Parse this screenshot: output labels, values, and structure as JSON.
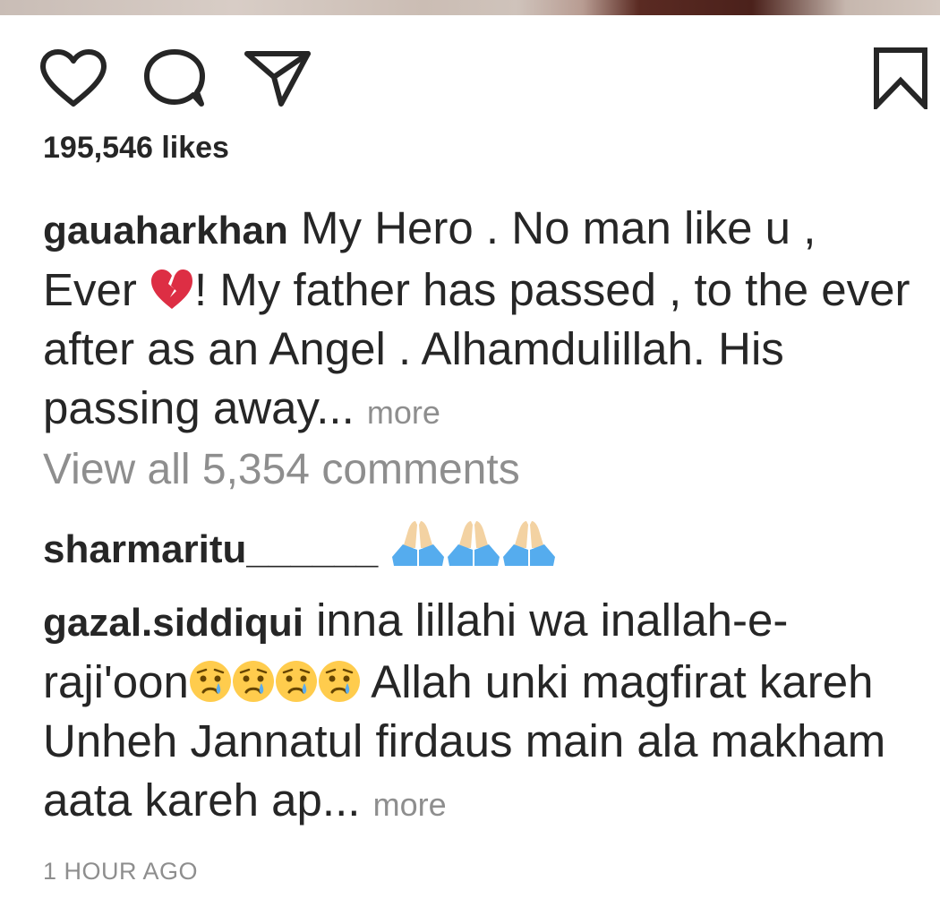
{
  "post": {
    "likes_text": "195,546 likes",
    "caption": {
      "username": "gauaharkhan",
      "text_part1": " My Hero . No man like u , Ever ",
      "emoji": "broken-heart",
      "text_part2": "! My father has passed , to the ever after as an Angel . Alhamdulillah. His passing away... ",
      "more_label": "more"
    },
    "view_all_comments": "View all 5,354 comments",
    "comments": [
      {
        "username": "sharmaritu______",
        "emojis": [
          "folded-hands",
          "folded-hands",
          "folded-hands"
        ]
      },
      {
        "username": "gazal.siddiqui",
        "text_part1": " inna lillahi wa inallah-e-raji'oon",
        "emojis": [
          "crying-face",
          "crying-face",
          "crying-face",
          "crying-face"
        ],
        "text_part2": " Allah unki magfirat kareh Unheh Jannatul firdaus main ala makham aata kareh ap... ",
        "more_label": "more"
      }
    ],
    "time_ago": "1 HOUR AGO"
  },
  "icons": {
    "like": "heart-outline-icon",
    "comment": "speech-bubble-icon",
    "share": "paper-plane-icon",
    "save": "bookmark-icon"
  },
  "colors": {
    "text": "#262626",
    "muted": "#8e8e8e",
    "broken_heart": "#dd2e44",
    "folded_hands_skin": "#f3d2a2",
    "sleeve": "#55acee",
    "emoji_face": "#ffcc4d",
    "tear": "#5dadec"
  }
}
